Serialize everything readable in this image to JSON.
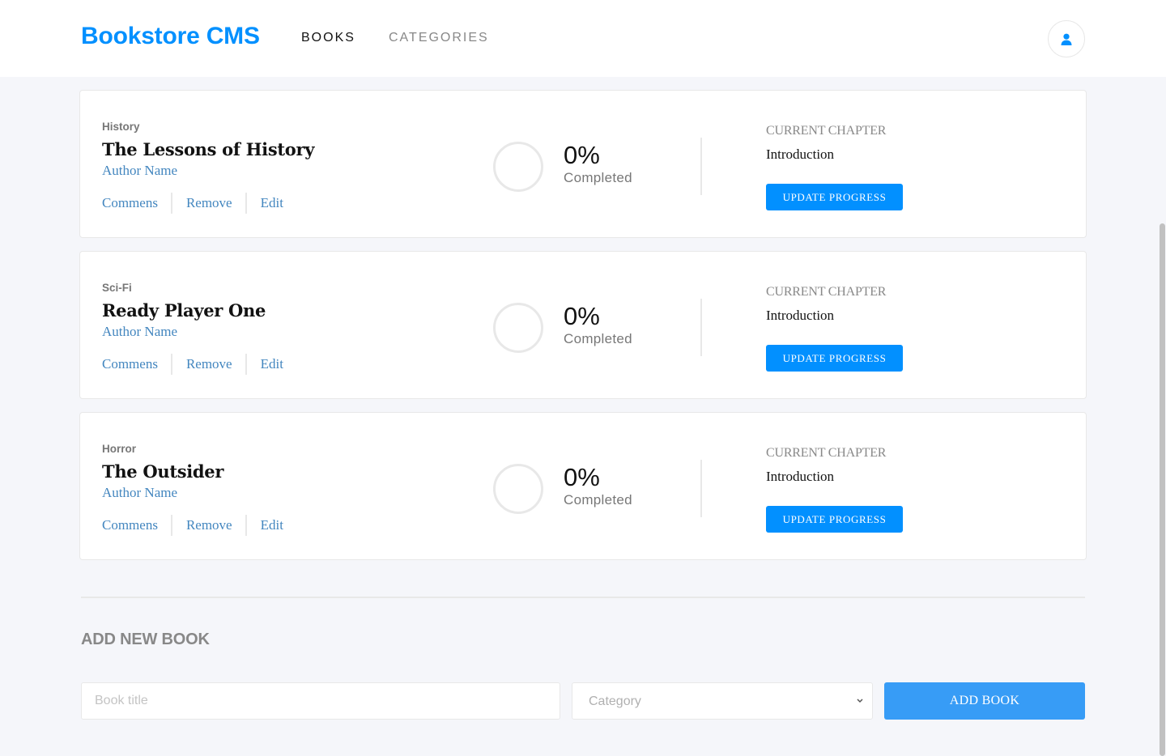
{
  "header": {
    "brand": "Bookstore CMS",
    "nav": [
      {
        "label": "BOOKS"
      },
      {
        "label": "CATEGORIES"
      }
    ],
    "user_icon": "user-icon"
  },
  "books": [
    {
      "genre": "History",
      "title": "The Lessons of History",
      "author": "Author Name",
      "actions": [
        "Commens",
        "Remove",
        "Edit"
      ],
      "progress_percent": "0%",
      "progress_label": "Completed",
      "chapter_label": "CURRENT CHAPTER",
      "chapter_value": "Introduction",
      "update_label": "UPDATE PROGRESS"
    },
    {
      "genre": "Sci-Fi",
      "title": "Ready Player One",
      "author": "Author Name",
      "actions": [
        "Commens",
        "Remove",
        "Edit"
      ],
      "progress_percent": "0%",
      "progress_label": "Completed",
      "chapter_label": "CURRENT CHAPTER",
      "chapter_value": "Introduction",
      "update_label": "UPDATE PROGRESS"
    },
    {
      "genre": "Horror",
      "title": "The Outsider",
      "author": "Author Name",
      "actions": [
        "Commens",
        "Remove",
        "Edit"
      ],
      "progress_percent": "0%",
      "progress_label": "Completed",
      "chapter_label": "CURRENT CHAPTER",
      "chapter_value": "Introduction",
      "update_label": "UPDATE PROGRESS"
    }
  ],
  "add_form": {
    "heading": "ADD NEW BOOK",
    "title_placeholder": "Book title",
    "category_selected": "Category",
    "submit_label": "ADD BOOK"
  },
  "colors": {
    "brand": "#0290ff",
    "link": "#4386bf",
    "button": "#0290ff",
    "add_button": "#379cf6"
  }
}
